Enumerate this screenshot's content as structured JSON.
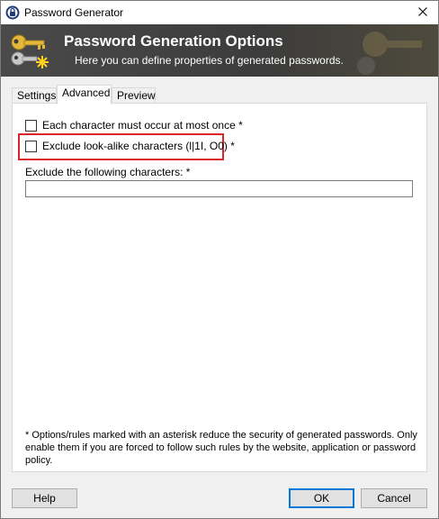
{
  "window": {
    "title": "Password Generator"
  },
  "banner": {
    "title": "Password Generation Options",
    "subtitle": "Here you can define properties of generated passwords."
  },
  "tabs": [
    {
      "label": "Settings",
      "active": false
    },
    {
      "label": "Advanced",
      "active": true
    },
    {
      "label": "Preview",
      "active": false
    }
  ],
  "advanced": {
    "options": [
      {
        "label": "Each character must occur at most once *",
        "checked": false
      },
      {
        "label": "Exclude look-alike characters (l|1I, O0) *",
        "checked": false
      }
    ],
    "exclude_label": "Exclude the following characters: *",
    "exclude_value": "",
    "footnote": "* Options/rules marked with an asterisk reduce the security of generated passwords. Only enable them if you are forced to follow such rules by the website, application or password policy."
  },
  "buttons": {
    "help": "Help",
    "ok": "OK",
    "cancel": "Cancel"
  },
  "colors": {
    "highlight": "#d9262b",
    "banner": "#3c3c3c",
    "default_button_border": "#0078d7"
  }
}
